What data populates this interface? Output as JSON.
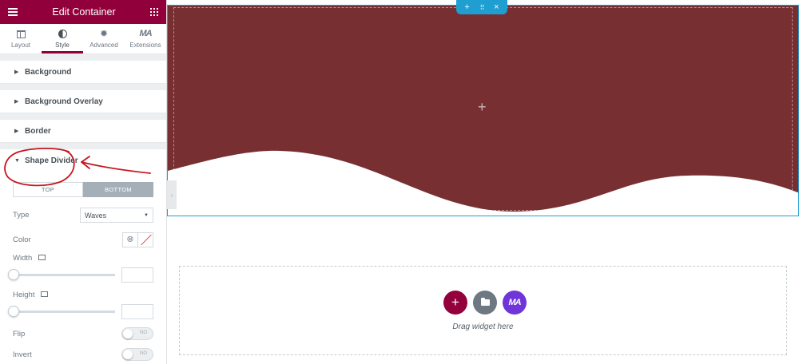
{
  "header": {
    "title": "Edit Container",
    "menu_icon": "hamburger-icon",
    "apps_icon": "grid-icon"
  },
  "tabs": [
    {
      "label": "Layout",
      "icon": "layout-icon",
      "active": false
    },
    {
      "label": "Style",
      "icon": "half-circle-icon",
      "active": true
    },
    {
      "label": "Advanced",
      "icon": "gear-icon",
      "active": false
    },
    {
      "label": "Extensions",
      "icon": "ma-logo-icon",
      "active": false
    }
  ],
  "sections": {
    "background": "Background",
    "background_overlay": "Background Overlay",
    "border": "Border",
    "shape_divider": "Shape Divider"
  },
  "shape_divider": {
    "segment": {
      "top": "TOP",
      "bottom": "BOTTOM",
      "selected": "BOTTOM"
    },
    "type": {
      "label": "Type",
      "value": "Waves"
    },
    "color": {
      "label": "Color"
    },
    "width": {
      "label": "Width",
      "value": 0
    },
    "height": {
      "label": "Height",
      "value": 0
    },
    "flip": {
      "label": "Flip",
      "state": "NO"
    },
    "invert": {
      "label": "Invert",
      "state": "NO"
    }
  },
  "canvas": {
    "section_color": "#772f32",
    "handle": {
      "add": "+",
      "move": "⠿",
      "close": "×"
    },
    "center_plus": "+",
    "dropzone": {
      "text": "Drag widget here"
    }
  },
  "colors": {
    "brand": "#92003b",
    "accent_blue": "#1e9ed1",
    "annotation_red": "#c8141e",
    "ma_purple": "#6f35d9"
  }
}
